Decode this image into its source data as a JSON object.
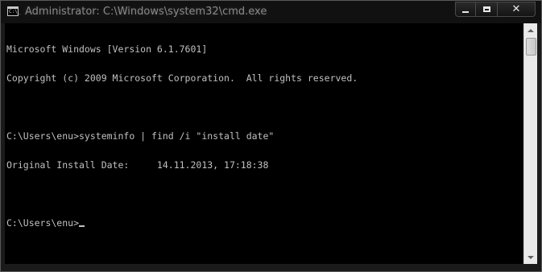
{
  "window": {
    "title": "Administrator: C:\\Windows\\system32\\cmd.exe",
    "icon": "cmd-icon",
    "icon_glyph": "C:\\_"
  },
  "caption_buttons": {
    "minimize_icon": "minimize-icon",
    "maximize_icon": "maximize-icon",
    "close_icon": "close-icon",
    "close_glyph": "✕"
  },
  "console": {
    "lines": [
      "Microsoft Windows [Version 6.1.7601]",
      "Copyright (c) 2009 Microsoft Corporation.  All rights reserved.",
      "",
      "C:\\Users\\enu>systeminfo | find /i \"install date\"",
      "Original Install Date:     14.11.2013, 17:18:38",
      "",
      "C:\\Users\\enu>"
    ],
    "text_color": "#c0c0c0",
    "background_color": "#000000"
  },
  "scrollbar": {
    "up_icon": "scroll-up-arrow-icon",
    "down_icon": "scroll-down-arrow-icon"
  }
}
